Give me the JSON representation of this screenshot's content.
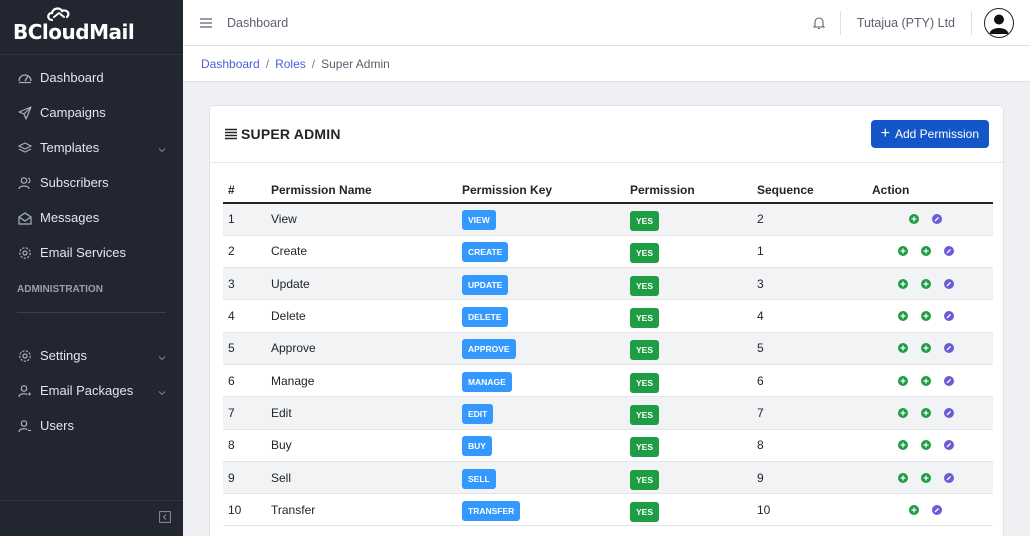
{
  "brand": {
    "name": "BCloudMail"
  },
  "sidebar": {
    "items": [
      {
        "label": "Dashboard",
        "icon": "dashboard-icon",
        "has_chevron": false
      },
      {
        "label": "Campaigns",
        "icon": "paper-plane-icon",
        "has_chevron": false
      },
      {
        "label": "Templates",
        "icon": "layers-icon",
        "has_chevron": true
      },
      {
        "label": "Subscribers",
        "icon": "users-icon",
        "has_chevron": false
      },
      {
        "label": "Messages",
        "icon": "envelope-open-icon",
        "has_chevron": false
      },
      {
        "label": "Email Services",
        "icon": "gear-icon",
        "has_chevron": false
      }
    ],
    "section_title": "ADMINISTRATION",
    "admin_items": [
      {
        "label": "Settings",
        "icon": "settings-icon",
        "has_chevron": true
      },
      {
        "label": "Email Packages",
        "icon": "user-package-icon",
        "has_chevron": true
      },
      {
        "label": "Users",
        "icon": "user-icon",
        "has_chevron": false
      }
    ]
  },
  "header": {
    "title": "Dashboard",
    "company": "Tutajua (PTY) Ltd"
  },
  "breadcrumb": [
    {
      "label": "Dashboard",
      "active": false
    },
    {
      "label": "Roles",
      "active": false
    },
    {
      "label": "Super Admin",
      "active": true
    }
  ],
  "card": {
    "title": "SUPER ADMIN",
    "add_button": "Add Permission",
    "columns": [
      "#",
      "Permission Name",
      "Permission Key",
      "Permission",
      "Sequence",
      "Action"
    ],
    "rows": [
      {
        "num": "1",
        "name": "View",
        "key": "VIEW",
        "permission": "YES",
        "sequence": "2",
        "actions": 1
      },
      {
        "num": "2",
        "name": "Create",
        "key": "CREATE",
        "permission": "YES",
        "sequence": "1",
        "actions": 2
      },
      {
        "num": "3",
        "name": "Update",
        "key": "UPDATE",
        "permission": "YES",
        "sequence": "3",
        "actions": 2
      },
      {
        "num": "4",
        "name": "Delete",
        "key": "DELETE",
        "permission": "YES",
        "sequence": "4",
        "actions": 2
      },
      {
        "num": "5",
        "name": "Approve",
        "key": "APPROVE",
        "permission": "YES",
        "sequence": "5",
        "actions": 2
      },
      {
        "num": "6",
        "name": "Manage",
        "key": "MANAGE",
        "permission": "YES",
        "sequence": "6",
        "actions": 2
      },
      {
        "num": "7",
        "name": "Edit",
        "key": "EDIT",
        "permission": "YES",
        "sequence": "7",
        "actions": 2
      },
      {
        "num": "8",
        "name": "Buy",
        "key": "BUY",
        "permission": "YES",
        "sequence": "8",
        "actions": 2
      },
      {
        "num": "9",
        "name": "Sell",
        "key": "SELL",
        "permission": "YES",
        "sequence": "9",
        "actions": 2
      },
      {
        "num": "10",
        "name": "Transfer",
        "key": "TRANSFER",
        "permission": "YES",
        "sequence": "10",
        "actions": 1
      }
    ]
  },
  "colors": {
    "sidebar_bg": "#212631",
    "primary_button": "#1356c8",
    "key_badge": "#3399ff",
    "yes_badge": "#1f9d45",
    "action_green": "#1f9d45",
    "action_purple": "#6a5bd6",
    "link": "#4b5fd6"
  }
}
